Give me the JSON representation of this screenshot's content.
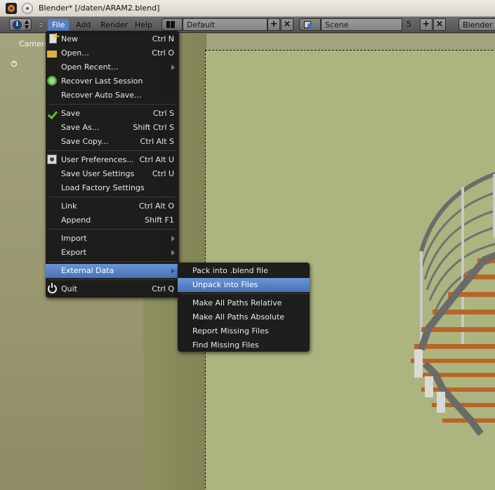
{
  "window": {
    "title": "Blender* [/daten/ARAM2.blend]"
  },
  "header": {
    "menus": [
      "File",
      "Add",
      "Render",
      "Help"
    ],
    "layout_name": "Default",
    "scene_name": "Scene",
    "scene_users": "5",
    "render_engine": "Blender R"
  },
  "viewport": {
    "label": "Camera"
  },
  "file_menu": {
    "items": [
      {
        "label": "New",
        "shortcut": "Ctrl N",
        "icon": "new-file-icon"
      },
      {
        "label": "Open...",
        "shortcut": "Ctrl O",
        "icon": "folder-icon"
      },
      {
        "label": "Open Recent...",
        "shortcut": "",
        "submenu": true
      },
      {
        "label": "Recover Last Session",
        "shortcut": "",
        "icon": "recover-icon"
      },
      {
        "label": "Recover Auto Save...",
        "shortcut": ""
      },
      {
        "label": "Save",
        "shortcut": "Ctrl S",
        "icon": "checkmark-icon"
      },
      {
        "label": "Save As...",
        "shortcut": "Shift Ctrl S"
      },
      {
        "label": "Save Copy...",
        "shortcut": "Ctrl Alt S"
      },
      {
        "label": "User Preferences...",
        "shortcut": "Ctrl Alt U",
        "icon": "preferences-icon"
      },
      {
        "label": "Save User Settings",
        "shortcut": "Ctrl U"
      },
      {
        "label": "Load Factory Settings",
        "shortcut": ""
      },
      {
        "label": "Link",
        "shortcut": "Ctrl Alt O"
      },
      {
        "label": "Append",
        "shortcut": "Shift F1"
      },
      {
        "label": "Import",
        "shortcut": "",
        "submenu": true
      },
      {
        "label": "Export",
        "shortcut": "",
        "submenu": true
      },
      {
        "label": "External Data",
        "shortcut": "",
        "submenu": true,
        "highlighted": true
      },
      {
        "label": "Quit",
        "shortcut": "Ctrl Q",
        "icon": "power-icon"
      }
    ]
  },
  "external_data_menu": {
    "items": [
      {
        "label": "Pack into .blend file"
      },
      {
        "label": "Unpack into Files",
        "highlighted": true
      },
      {
        "label": "Make All Paths Relative"
      },
      {
        "label": "Make All Paths Absolute"
      },
      {
        "label": "Report Missing Files"
      },
      {
        "label": "Find Missing Files"
      }
    ]
  },
  "colors": {
    "highlight": "#5a86cc",
    "menu_bg": "#181818",
    "viewport_bg": "#acb47f"
  }
}
